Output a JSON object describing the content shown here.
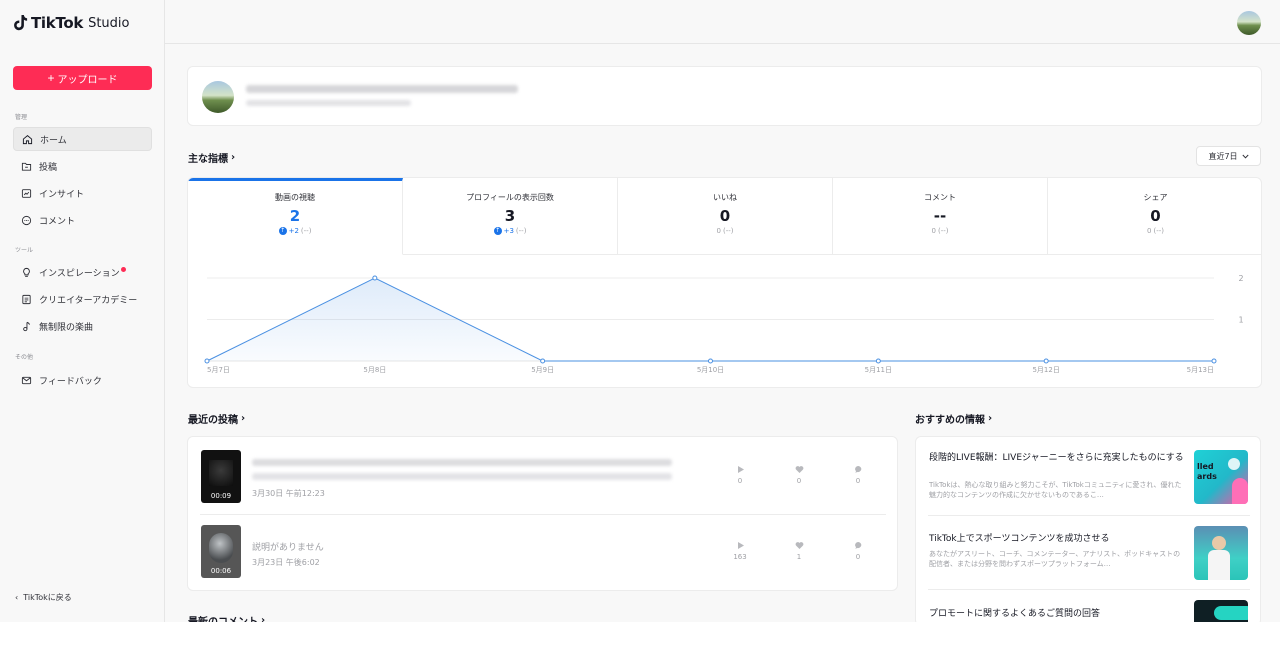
{
  "app": {
    "logo_brand": "TikTok",
    "logo_suffix": "Studio"
  },
  "sidebar": {
    "upload_label": "アップロード",
    "sections": {
      "manage": "管理",
      "tools": "ツール",
      "other": "その他"
    },
    "items": [
      {
        "label": "ホーム"
      },
      {
        "label": "投稿"
      },
      {
        "label": "インサイト"
      },
      {
        "label": "コメント"
      },
      {
        "label": "インスピレーション"
      },
      {
        "label": "クリエイターアカデミー"
      },
      {
        "label": "無制限の楽曲"
      },
      {
        "label": "フィードバック"
      }
    ],
    "back_label": "TikTokに戻る"
  },
  "metrics": {
    "title": "主な指標",
    "range_label": "直近7日",
    "cards": [
      {
        "label": "動画の視聴",
        "value": "2",
        "delta": "+2",
        "delta_note": "(--)"
      },
      {
        "label": "プロフィールの表示回数",
        "value": "3",
        "delta": "+3",
        "delta_note": "(--)"
      },
      {
        "label": "いいね",
        "value": "0",
        "delta": "0",
        "delta_note": "(--)"
      },
      {
        "label": "コメント",
        "value": "--",
        "delta": "0",
        "delta_note": "(--)"
      },
      {
        "label": "シェア",
        "value": "0",
        "delta": "0",
        "delta_note": "(--)"
      }
    ]
  },
  "chart_data": {
    "type": "area",
    "x": [
      "5月7日",
      "5月8日",
      "5月9日",
      "5月10日",
      "5月11日",
      "5月12日",
      "5月13日"
    ],
    "series": [
      {
        "values": [
          0,
          2,
          0,
          0,
          0,
          0,
          0
        ]
      }
    ],
    "y_ticks": [
      "2",
      "1"
    ],
    "ylim": [
      0,
      2
    ],
    "grid": true,
    "color": "#4a90e2"
  },
  "posts": {
    "title": "最近の投稿",
    "items": [
      {
        "caption": "",
        "date": "3月30日 午前12:23",
        "duration": "00:09",
        "views": "0",
        "likes": "0",
        "comments": "0"
      },
      {
        "caption": "説明がありません",
        "date": "3月23日 午後6:02",
        "duration": "00:06",
        "views": "163",
        "likes": "1",
        "comments": "0"
      }
    ]
  },
  "comments_title": "最新のコメント",
  "recommendations": {
    "title": "おすすめの情報",
    "items": [
      {
        "title": "段階的LIVE報酬：LIVEジャーニーをさらに充実したものにする",
        "desc": "TikTokは、熱心な取り組みと努力こそが、TikTokコミュニティに愛され、優れた魅力的なコンテンツの作成に欠かせないものであるこ…"
      },
      {
        "title": "TikTok上でスポーツコンテンツを成功させる",
        "desc": "あなたがアスリート、コーチ、コメンテーター、アナリスト、ポッドキャストの配信者、または分野を問わずスポーツプラットフォーム…"
      },
      {
        "title": "プロモートに関するよくあるご質問の回答",
        "desc": ""
      }
    ]
  },
  "colors": {
    "accent": "#fe2c55",
    "chart_blue": "#1a73e8"
  }
}
